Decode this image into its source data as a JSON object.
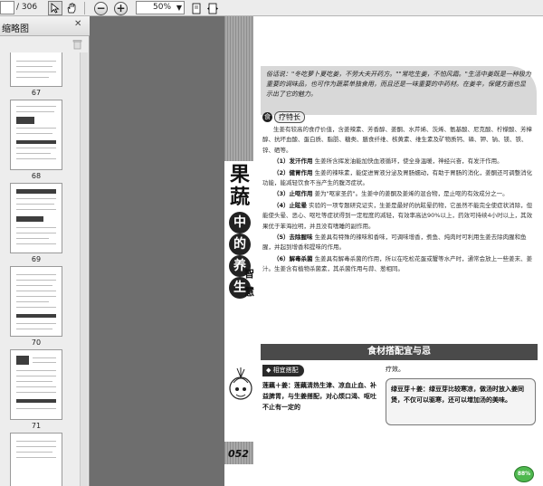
{
  "toolbar": {
    "current_page": "",
    "page_separator": "/ 306",
    "zoom_value": "50%"
  },
  "thumbnail_panel": {
    "title": "缩略图",
    "thumbnails": [
      {
        "label": "67"
      },
      {
        "label": "68"
      },
      {
        "label": "69"
      },
      {
        "label": "70"
      },
      {
        "label": "71"
      }
    ]
  },
  "page": {
    "side_title_1": "果",
    "side_title_2": "蔬",
    "side_circle_1": "中",
    "side_circle_2": "的",
    "side_circle_3": "养",
    "side_circle_4": "生",
    "side_small_1": "智",
    "side_small_2": "慧",
    "page_number": "052",
    "intro_text": "俗话说：\"冬吃萝卜夏吃姜，不劳大夫开药方。\"\"常吃生姜，不怕风霜。\"生活中姜既是一种极为重要的调味品，也可作为蔬菜单独食用，而且还是一味重要的中药材。在姜辛，保健方面也显示出了它的魅力。",
    "section_label": "疗特长",
    "section_icon": "食",
    "paragraphs": [
      {
        "lead": "",
        "text": "生姜有较高的食疗价值，含姜辣素、芳香醇、姜酮、水芹烯、茨烯、氨基酸、尼克酸、柠檬酸、芳樟醇、抗坏血酸、蛋白质、脂肪、糖类、膳食纤维、核黄素、维生素及矿物质钙、磷、钾、钠、镁、铁、锌、硒等。"
      },
      {
        "lead": "（1）发汗作用",
        "text": "生姜所含挥发油能加快血液循环，使全身温暖，神经兴奋，有发汗作用。"
      },
      {
        "lead": "（2）健胃作用",
        "text": "生姜的辣味素，能促进胃液分泌及胃肠蠕动，有助于胃肠的消化，姜酮还可调整消化功能，能减轻饮食不当产生的腹泻症状。"
      },
      {
        "lead": "（3）止呕作用",
        "text": "姜为\"呕家圣药\"。生姜中的姜酮及姜烯的混合物，是止呕的有效成分之一。"
      },
      {
        "lead": "（4）止眩晕",
        "text": "实验的一项专题研究证实，生姜是最好的抗眩晕药物，它虽然不能完全使症状消除，但能使头晕、恶心、呕吐等症状得到一定程度的减轻，有效率高达90%以上，药效可持续4小时以上，其效果优于苯海拉明，并且没有嗜睡的副作用。"
      },
      {
        "lead": "（5）去除腥味",
        "text": "生姜具有特殊的辣味和香味，可调味增香，煮鱼、炖肉时可利用生姜去除肉腥和鱼腥，并起到增香和提味的作用。"
      },
      {
        "lead": "（6）解毒杀菌",
        "text": "生姜具有解毒杀菌的作用，所以在吃松花蛋或蟹等水产时，通常会放上一些姜末、姜汁。生姜含有植物杀菌素，其杀菌作用与蒜、葱相同。"
      }
    ],
    "pairing_header": "食材搭配宜与忌",
    "pairing_sub": "相宜搭配",
    "pairing_left": "莲藕＋姜：莲藕清热生津、凉血止血、补益脾胃，与生姜搭配，对心烦口渴、呕吐不止有一定的",
    "pairing_right_top": "疗效。",
    "pairing_right_box": "绿豆芽＋姜：绿豆芽比较寒凉，做汤时放入姜同煲，不仅可以驱寒，还可以增加汤的美味。"
  },
  "status": {
    "zoom_indicator": "88%"
  },
  "colors": {
    "toolbar_bg": "#ececec",
    "doc_bg": "#6e6e6e",
    "intro_bg": "#d8d8d8",
    "header_dark": "#4a4a4a",
    "zoom_badge": "#4fb84f"
  }
}
